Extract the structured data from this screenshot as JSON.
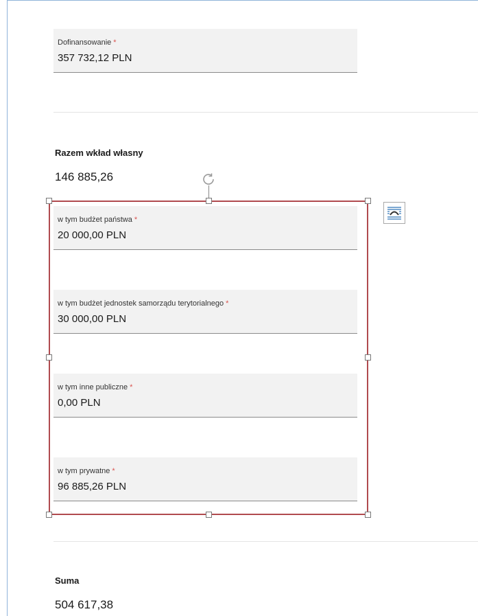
{
  "form": {
    "dofinansowanie": {
      "label": "Dofinansowanie",
      "value": "357 732,12 PLN"
    },
    "razem": {
      "title": "Razem wkład własny",
      "value": "146 885,26"
    },
    "fields": [
      {
        "label": "w tym budżet państwa",
        "value": "20 000,00 PLN"
      },
      {
        "label": "w tym budżet jednostek samorządu terytorialnego",
        "value": "30 000,00 PLN"
      },
      {
        "label": "w tym inne publiczne",
        "value": "0,00 PLN"
      },
      {
        "label": "w tym prywatne",
        "value": "96 885,26 PLN"
      }
    ],
    "suma": {
      "title": "Suma",
      "value": "504 617,38"
    },
    "required_mark": "*"
  },
  "colors": {
    "selection_border": "#b04a4e",
    "required": "#d9534f",
    "field_bg": "#f2f2f2"
  },
  "icons": {
    "rotate": "rotate-handle-icon",
    "layout": "layout-options-icon"
  }
}
